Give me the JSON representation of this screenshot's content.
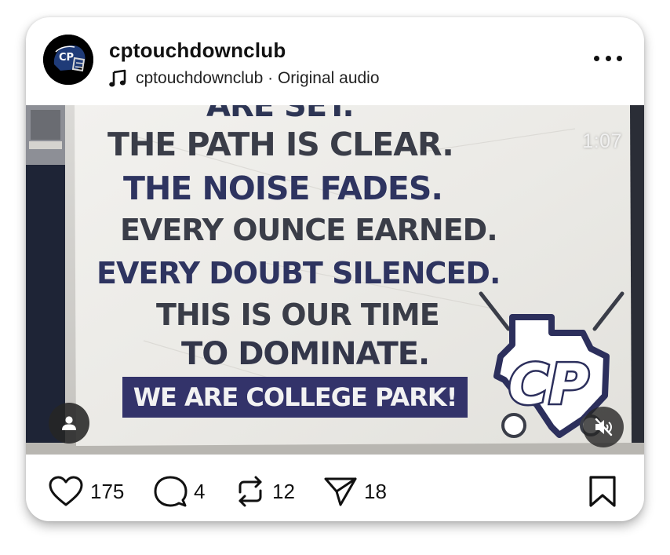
{
  "post": {
    "username": "cptouchdownclub",
    "audio": {
      "artist": "cptouchdownclub",
      "separator": " · ",
      "track": "Original audio"
    },
    "more_icon": "more-horizontal-icon"
  },
  "media": {
    "type": "video",
    "timer": "1:07",
    "banner": {
      "top_partial": "ARE SET.",
      "lines": [
        "THE PATH IS CLEAR.",
        "THE NOISE FADES.",
        "EVERY OUNCE EARNED.",
        "EVERY DOUBT SILENCED.",
        "THIS IS OUR TIME",
        "TO DOMINATE."
      ],
      "band": "WE ARE COLLEGE PARK!",
      "logo_text": "CP"
    },
    "tag_icon": "user-tag-icon",
    "mute_icon": "speaker-muted-icon"
  },
  "actions": {
    "likes": "175",
    "comments": "4",
    "reposts": "12",
    "shares": "18"
  },
  "colors": {
    "accent_navy": "#33336a",
    "text": "#111111",
    "card_bg": "#ffffff"
  }
}
